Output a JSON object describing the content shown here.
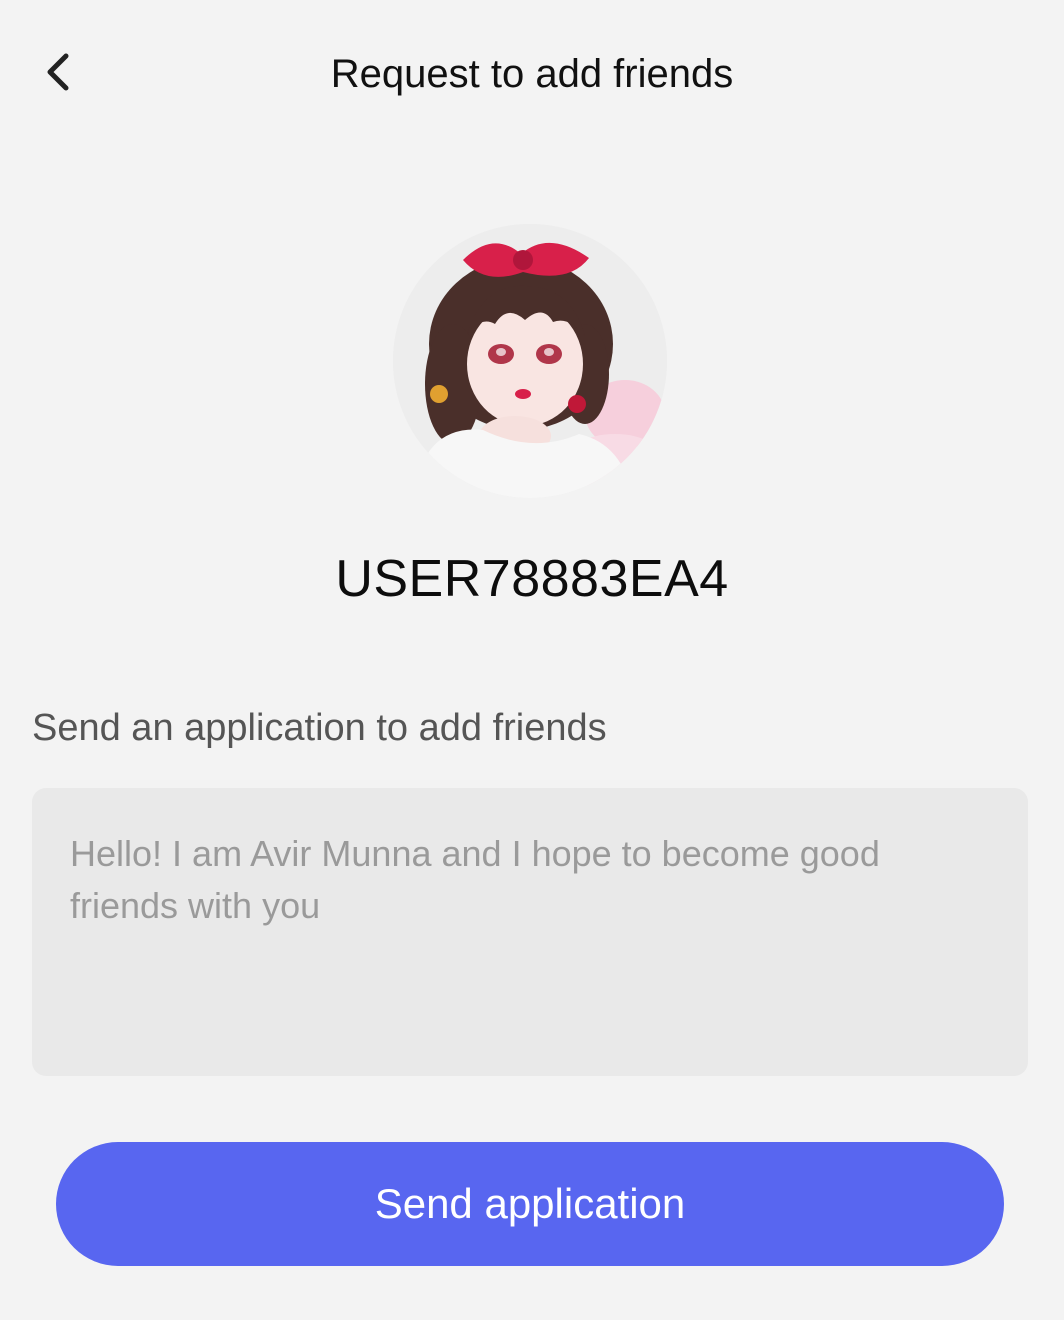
{
  "header": {
    "title": "Request to add friends",
    "back_icon": "chevron-left-icon"
  },
  "profile": {
    "username": "USER78883EA4"
  },
  "form": {
    "label": "Send an application to add friends",
    "message_placeholder": "Hello! I am Avir Munna and I hope to become good friends with you",
    "message_value": ""
  },
  "actions": {
    "send_label": "Send application"
  },
  "colors": {
    "accent": "#5866f0",
    "background": "#f3f3f3",
    "input_background": "#e9e9e9"
  }
}
